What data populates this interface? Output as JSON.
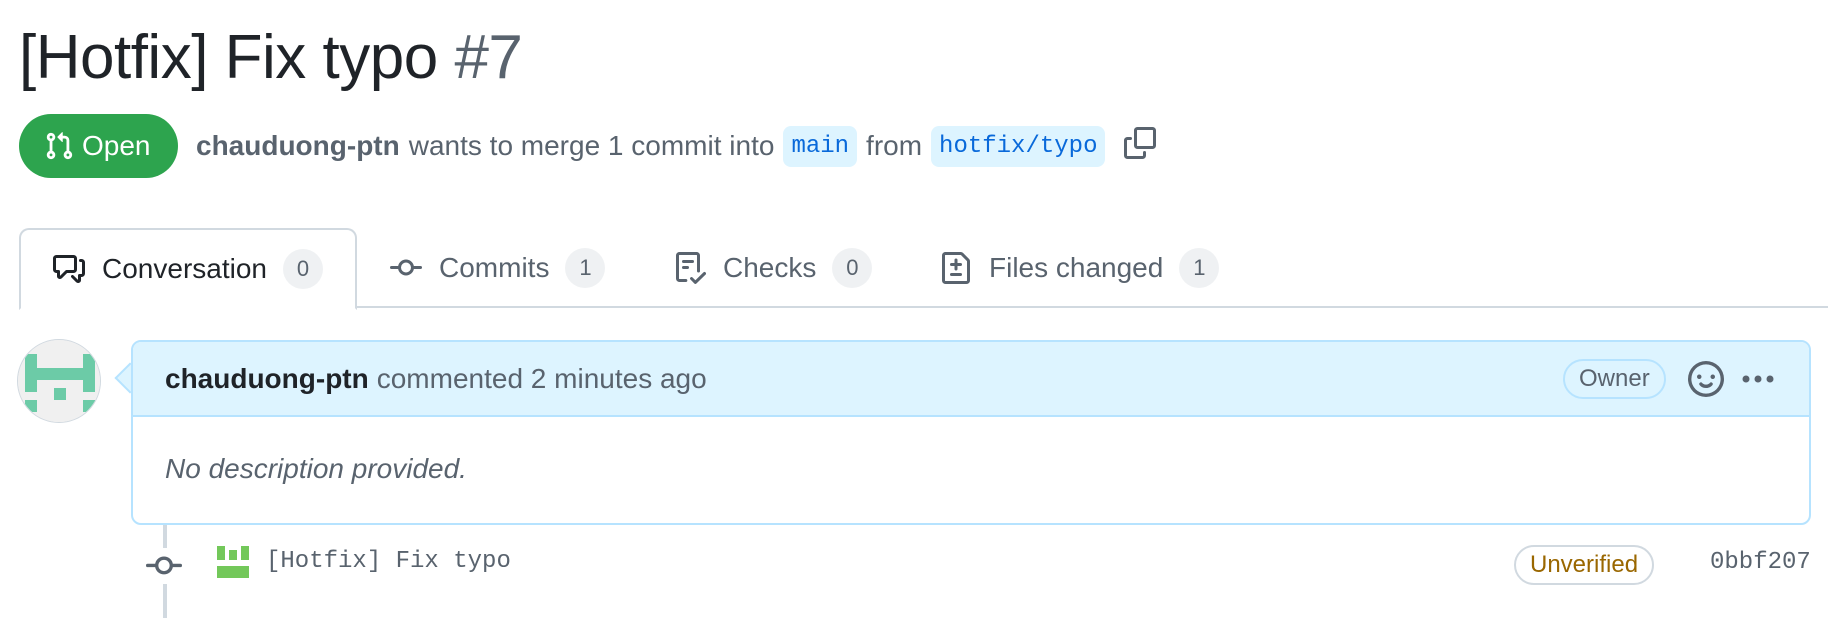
{
  "pr": {
    "title": "[Hotfix] Fix typo",
    "number": "#7",
    "state": "Open",
    "state_color": "#2da44e",
    "author": "chauduong-ptn",
    "merge_text": "wants to merge 1 commit into",
    "base_branch": "main",
    "from_text": "from",
    "head_branch": "hotfix/typo"
  },
  "tabs": [
    {
      "label": "Conversation",
      "count": "0",
      "icon": "comment-discussion-icon",
      "selected": true
    },
    {
      "label": "Commits",
      "count": "1",
      "icon": "git-commit-icon",
      "selected": false
    },
    {
      "label": "Checks",
      "count": "0",
      "icon": "checklist-icon",
      "selected": false
    },
    {
      "label": "Files changed",
      "count": "1",
      "icon": "file-diff-icon",
      "selected": false
    }
  ],
  "comment": {
    "author": "chauduong-ptn",
    "action": "commented 2 minutes ago",
    "badge": "Owner",
    "body": "No description provided."
  },
  "commit": {
    "message": "[Hotfix] Fix typo",
    "verification": "Unverified",
    "sha": "0bbf207"
  },
  "colors": {
    "accent_blue": "#0969da",
    "header_bg": "#ddf4ff",
    "warning": "#9a6700",
    "identicon": "#6ccba7"
  }
}
